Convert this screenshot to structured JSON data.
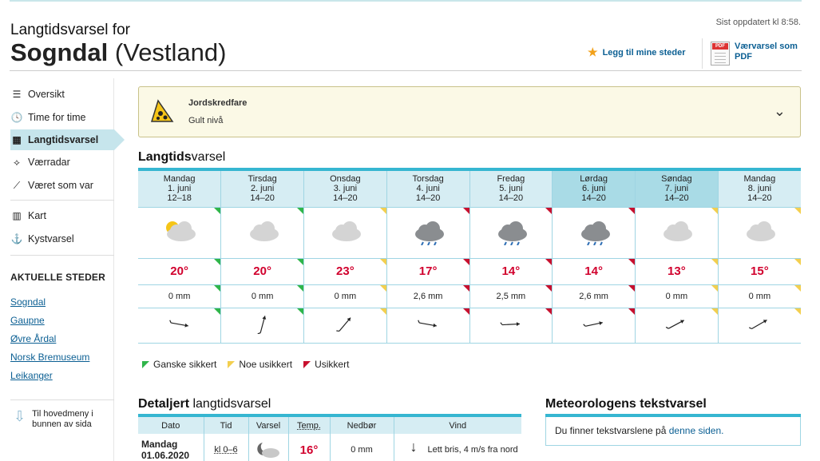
{
  "header": {
    "subtitle": "Langtidsvarsel for",
    "place": "Sogndal",
    "region": "(Vestland)",
    "updated": "Sist oppdatert kl 8:58.",
    "add_fav": "Legg til mine steder",
    "pdf": "Værvarsel som PDF"
  },
  "nav": [
    {
      "label": "Oversikt",
      "icon": "list-icon"
    },
    {
      "label": "Time for time",
      "icon": "clock-icon"
    },
    {
      "label": "Langtidsvarsel",
      "icon": "calendar-icon"
    },
    {
      "label": "Værradar",
      "icon": "radar-icon"
    },
    {
      "label": "Været som var",
      "icon": "chart-icon"
    },
    {
      "label": "Kart",
      "icon": "map-icon"
    },
    {
      "label": "Kystvarsel",
      "icon": "anchor-icon"
    }
  ],
  "places_heading": "AKTUELLE STEDER",
  "places": [
    "Sogndal",
    "Gaupne",
    "Øvre Årdal",
    "Norsk Bremuseum",
    "Leikanger"
  ],
  "back_link": "Til hovedmeny i bunnen av sida",
  "warning": {
    "title": "Jordskredfare",
    "level": "Gult nivå"
  },
  "longterm": {
    "title_bold": "Langtids",
    "title_rest": "varsel",
    "days": [
      {
        "day": "Mandag",
        "date": "1. juni",
        "hours": "12–18",
        "weather": "partly-cloudy",
        "temp": "20°",
        "precip": "0 mm",
        "wind_deg": 10,
        "conf": "g"
      },
      {
        "day": "Tirsdag",
        "date": "2. juni",
        "hours": "14–20",
        "weather": "cloudy",
        "temp": "20°",
        "precip": "0 mm",
        "wind_deg": -75,
        "conf": "g"
      },
      {
        "day": "Onsdag",
        "date": "3. juni",
        "hours": "14–20",
        "weather": "cloudy",
        "temp": "23°",
        "precip": "0 mm",
        "wind_deg": -50,
        "conf": "y"
      },
      {
        "day": "Torsdag",
        "date": "4. juni",
        "hours": "14–20",
        "weather": "rain",
        "temp": "17°",
        "precip": "2,6 mm",
        "wind_deg": 10,
        "conf": "r"
      },
      {
        "day": "Fredag",
        "date": "5. juni",
        "hours": "14–20",
        "weather": "rain",
        "temp": "14°",
        "precip": "2,5 mm",
        "wind_deg": -3,
        "conf": "r"
      },
      {
        "day": "Lørdag",
        "date": "6. juni",
        "hours": "14–20",
        "weather": "rain",
        "temp": "14°",
        "precip": "2,6 mm",
        "wind_deg": -12,
        "conf": "r",
        "weekend": true
      },
      {
        "day": "Søndag",
        "date": "7. juni",
        "hours": "14–20",
        "weather": "cloudy",
        "temp": "13°",
        "precip": "0 mm",
        "wind_deg": -28,
        "conf": "y",
        "weekend": true
      },
      {
        "day": "Mandag",
        "date": "8. juni",
        "hours": "14–20",
        "weather": "cloudy",
        "temp": "15°",
        "precip": "0 mm",
        "wind_deg": -30,
        "conf": "y"
      }
    ]
  },
  "legend": [
    {
      "label": "Ganske sikkert",
      "color": "#2fb54a"
    },
    {
      "label": "Noe usikkert",
      "color": "#f3cf4f"
    },
    {
      "label": "Usikkert",
      "color": "#c8102e"
    }
  ],
  "detail": {
    "title_bold": "Detaljert",
    "title_rest": " langtidsvarsel",
    "headers": [
      "Dato",
      "Tid",
      "Varsel",
      "Temp.",
      "Nedbør",
      "Vind"
    ],
    "row": {
      "day": "Mandag",
      "date": "01.06.2020",
      "time": "kl 0–6",
      "temp": "16°",
      "precip": "0 mm",
      "wind": "Lett bris, 4 m/s fra nord"
    }
  },
  "meteorologist": {
    "title": "Meteorologens tekstvarsel",
    "text": "Du finner tekstvarslene på ",
    "link": "denne siden."
  }
}
